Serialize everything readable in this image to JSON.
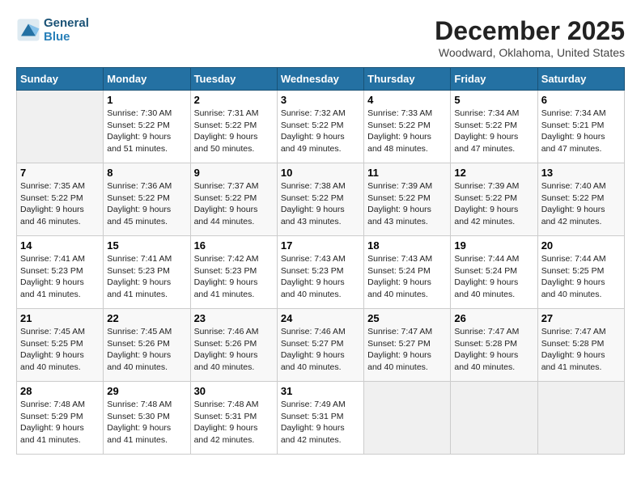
{
  "header": {
    "logo_line1": "General",
    "logo_line2": "Blue",
    "month": "December 2025",
    "location": "Woodward, Oklahoma, United States"
  },
  "weekdays": [
    "Sunday",
    "Monday",
    "Tuesday",
    "Wednesday",
    "Thursday",
    "Friday",
    "Saturday"
  ],
  "weeks": [
    [
      {
        "day": "",
        "empty": true
      },
      {
        "day": "1",
        "sunrise": "7:30 AM",
        "sunset": "5:22 PM",
        "daylight": "9 hours and 51 minutes."
      },
      {
        "day": "2",
        "sunrise": "7:31 AM",
        "sunset": "5:22 PM",
        "daylight": "9 hours and 50 minutes."
      },
      {
        "day": "3",
        "sunrise": "7:32 AM",
        "sunset": "5:22 PM",
        "daylight": "9 hours and 49 minutes."
      },
      {
        "day": "4",
        "sunrise": "7:33 AM",
        "sunset": "5:22 PM",
        "daylight": "9 hours and 48 minutes."
      },
      {
        "day": "5",
        "sunrise": "7:34 AM",
        "sunset": "5:22 PM",
        "daylight": "9 hours and 47 minutes."
      },
      {
        "day": "6",
        "sunrise": "7:34 AM",
        "sunset": "5:21 PM",
        "daylight": "9 hours and 47 minutes."
      }
    ],
    [
      {
        "day": "7",
        "sunrise": "7:35 AM",
        "sunset": "5:22 PM",
        "daylight": "9 hours and 46 minutes."
      },
      {
        "day": "8",
        "sunrise": "7:36 AM",
        "sunset": "5:22 PM",
        "daylight": "9 hours and 45 minutes."
      },
      {
        "day": "9",
        "sunrise": "7:37 AM",
        "sunset": "5:22 PM",
        "daylight": "9 hours and 44 minutes."
      },
      {
        "day": "10",
        "sunrise": "7:38 AM",
        "sunset": "5:22 PM",
        "daylight": "9 hours and 43 minutes."
      },
      {
        "day": "11",
        "sunrise": "7:39 AM",
        "sunset": "5:22 PM",
        "daylight": "9 hours and 43 minutes."
      },
      {
        "day": "12",
        "sunrise": "7:39 AM",
        "sunset": "5:22 PM",
        "daylight": "9 hours and 42 minutes."
      },
      {
        "day": "13",
        "sunrise": "7:40 AM",
        "sunset": "5:22 PM",
        "daylight": "9 hours and 42 minutes."
      }
    ],
    [
      {
        "day": "14",
        "sunrise": "7:41 AM",
        "sunset": "5:23 PM",
        "daylight": "9 hours and 41 minutes."
      },
      {
        "day": "15",
        "sunrise": "7:41 AM",
        "sunset": "5:23 PM",
        "daylight": "9 hours and 41 minutes."
      },
      {
        "day": "16",
        "sunrise": "7:42 AM",
        "sunset": "5:23 PM",
        "daylight": "9 hours and 41 minutes."
      },
      {
        "day": "17",
        "sunrise": "7:43 AM",
        "sunset": "5:23 PM",
        "daylight": "9 hours and 40 minutes."
      },
      {
        "day": "18",
        "sunrise": "7:43 AM",
        "sunset": "5:24 PM",
        "daylight": "9 hours and 40 minutes."
      },
      {
        "day": "19",
        "sunrise": "7:44 AM",
        "sunset": "5:24 PM",
        "daylight": "9 hours and 40 minutes."
      },
      {
        "day": "20",
        "sunrise": "7:44 AM",
        "sunset": "5:25 PM",
        "daylight": "9 hours and 40 minutes."
      }
    ],
    [
      {
        "day": "21",
        "sunrise": "7:45 AM",
        "sunset": "5:25 PM",
        "daylight": "9 hours and 40 minutes."
      },
      {
        "day": "22",
        "sunrise": "7:45 AM",
        "sunset": "5:26 PM",
        "daylight": "9 hours and 40 minutes."
      },
      {
        "day": "23",
        "sunrise": "7:46 AM",
        "sunset": "5:26 PM",
        "daylight": "9 hours and 40 minutes."
      },
      {
        "day": "24",
        "sunrise": "7:46 AM",
        "sunset": "5:27 PM",
        "daylight": "9 hours and 40 minutes."
      },
      {
        "day": "25",
        "sunrise": "7:47 AM",
        "sunset": "5:27 PM",
        "daylight": "9 hours and 40 minutes."
      },
      {
        "day": "26",
        "sunrise": "7:47 AM",
        "sunset": "5:28 PM",
        "daylight": "9 hours and 40 minutes."
      },
      {
        "day": "27",
        "sunrise": "7:47 AM",
        "sunset": "5:28 PM",
        "daylight": "9 hours and 41 minutes."
      }
    ],
    [
      {
        "day": "28",
        "sunrise": "7:48 AM",
        "sunset": "5:29 PM",
        "daylight": "9 hours and 41 minutes."
      },
      {
        "day": "29",
        "sunrise": "7:48 AM",
        "sunset": "5:30 PM",
        "daylight": "9 hours and 41 minutes."
      },
      {
        "day": "30",
        "sunrise": "7:48 AM",
        "sunset": "5:31 PM",
        "daylight": "9 hours and 42 minutes."
      },
      {
        "day": "31",
        "sunrise": "7:49 AM",
        "sunset": "5:31 PM",
        "daylight": "9 hours and 42 minutes."
      },
      {
        "day": "",
        "empty": true
      },
      {
        "day": "",
        "empty": true
      },
      {
        "day": "",
        "empty": true
      }
    ]
  ],
  "labels": {
    "sunrise": "Sunrise:",
    "sunset": "Sunset:",
    "daylight": "Daylight:"
  }
}
